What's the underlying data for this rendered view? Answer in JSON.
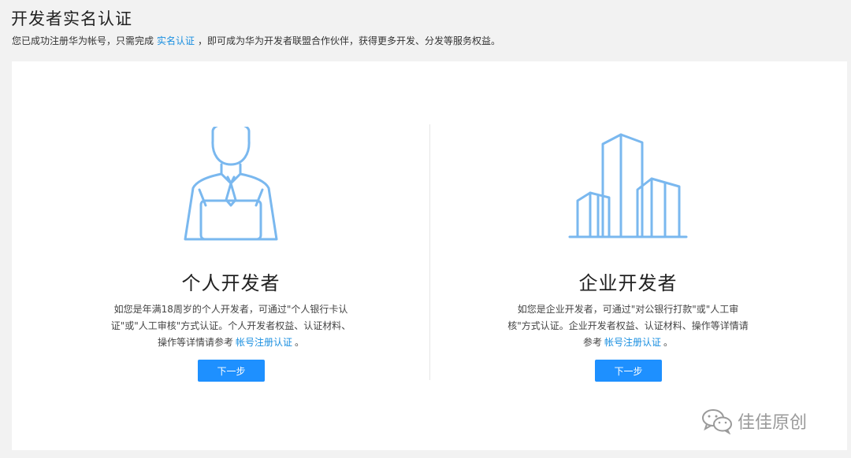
{
  "header": {
    "title": "开发者实名认证",
    "desc_before": "您已成功注册华为帐号，只需完成",
    "desc_link": "实名认证",
    "desc_after": "，即可成为华为开发者联盟合作伙伴，获得更多开发、分发等服务权益。"
  },
  "personal": {
    "title": "个人开发者",
    "desc_text": "如您是年满18周岁的个人开发者，可通过\"个人银行卡认证\"或\"人工审核\"方式认证。个人开发者权益、认证材料、操作等详情请参考",
    "desc_link": "帐号注册认证",
    "desc_end": "。",
    "button": "下一步",
    "icon": "person-laptop-icon"
  },
  "enterprise": {
    "title": "企业开发者",
    "desc_text": "如您是企业开发者，可通过\"对公银行打款\"或\"人工审核\"方式认证。企业开发者权益、认证材料、操作等详情请参考",
    "desc_link": "帐号注册认证",
    "desc_end": "。",
    "button": "下一步",
    "icon": "buildings-icon"
  },
  "watermark": {
    "text": "佳佳原创",
    "icon": "wechat-icon"
  },
  "colors": {
    "accent": "#1e90ff",
    "link": "#1a8fe0",
    "illustration": "#7ab8ef",
    "background": "#f2f2f2"
  }
}
